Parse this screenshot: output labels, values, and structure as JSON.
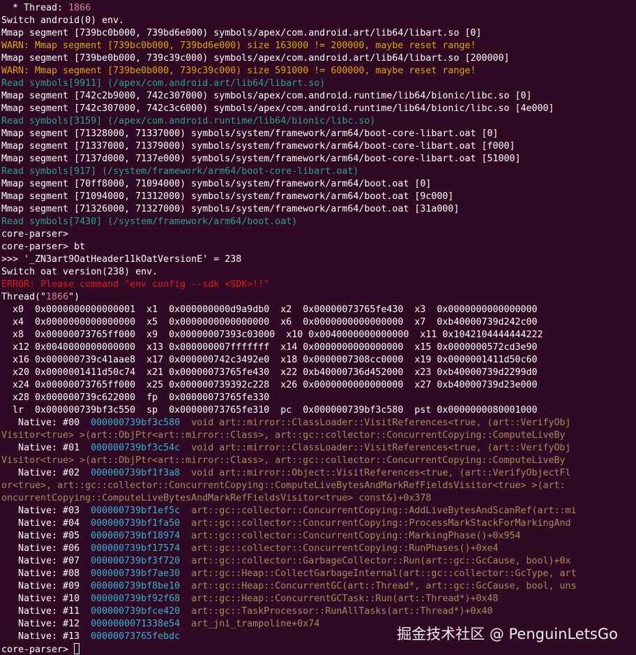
{
  "terminal": {
    "background": "#300a24",
    "colors": {
      "default": "#ffffff",
      "warn": "#e5a50a",
      "read": "#2aa198",
      "error": "#e01b24",
      "thread_id": "#d3869b",
      "frame_symbol": "#a88c5a",
      "frame_address": "#33b3d6"
    },
    "lines": [
      {
        "segs": [
          {
            "t": "  * Thread: ",
            "c": "white"
          },
          {
            "t": "1866",
            "c": "purple"
          }
        ]
      },
      {
        "segs": [
          {
            "t": "Switch android(0) env.",
            "c": "white"
          }
        ]
      },
      {
        "segs": [
          {
            "t": "Mmap segment [739bc0b000, 739bd6e000) symbols/apex/com.android.art/lib64/libart.so [0]",
            "c": "white"
          }
        ]
      },
      {
        "segs": [
          {
            "t": "WARN: Mmap segment [739bc0b000, 739bd6e000) size 163000 != 200000, maybe reset range!",
            "c": "warn"
          }
        ]
      },
      {
        "segs": [
          {
            "t": "Mmap segment [739be0b000, 739c39c000) symbols/apex/com.android.art/lib64/libart.so [200000]",
            "c": "white"
          }
        ]
      },
      {
        "segs": [
          {
            "t": "WARN: Mmap segment [739be0b000, 739c39c000) size 591000 != 600000, maybe reset range!",
            "c": "warn"
          }
        ]
      },
      {
        "segs": [
          {
            "t": "Read symbols[9911] (/apex/com.android.art/lib64/libart.so)",
            "c": "teal"
          }
        ]
      },
      {
        "segs": [
          {
            "t": "Mmap segment [742c2b9000, 742c307000) symbols/apex/com.android.runtime/lib64/bionic/libc.so [0]",
            "c": "white"
          }
        ]
      },
      {
        "segs": [
          {
            "t": "Mmap segment [742c307000, 742c3c6000) symbols/apex/com.android.runtime/lib64/bionic/libc.so [4e000]",
            "c": "white"
          }
        ]
      },
      {
        "segs": [
          {
            "t": "Read symbols[3159] (/apex/com.android.runtime/lib64/bionic/libc.so)",
            "c": "teal"
          }
        ]
      },
      {
        "segs": [
          {
            "t": "Mmap segment [71328000, 71337000) symbols/system/framework/arm64/boot-core-libart.oat [0]",
            "c": "white"
          }
        ]
      },
      {
        "segs": [
          {
            "t": "Mmap segment [71337000, 71379000) symbols/system/framework/arm64/boot-core-libart.oat [f000]",
            "c": "white"
          }
        ]
      },
      {
        "segs": [
          {
            "t": "Mmap segment [7137d000, 7137e000) symbols/system/framework/arm64/boot-core-libart.oat [51000]",
            "c": "white"
          }
        ]
      },
      {
        "segs": [
          {
            "t": "Read symbols[917] (/system/framework/arm64/boot-core-libart.oat)",
            "c": "teal"
          }
        ]
      },
      {
        "segs": [
          {
            "t": "Mmap segment [70ff8000, 71094000) symbols/system/framework/arm64/boot.oat [0]",
            "c": "white"
          }
        ]
      },
      {
        "segs": [
          {
            "t": "Mmap segment [71094000, 71312000) symbols/system/framework/arm64/boot.oat [9c000]",
            "c": "white"
          }
        ]
      },
      {
        "segs": [
          {
            "t": "Mmap segment [71326000, 71327000) symbols/system/framework/arm64/boot.oat [31a000]",
            "c": "white"
          }
        ]
      },
      {
        "segs": [
          {
            "t": "Read symbols[7430] (/system/framework/arm64/boot.oat)",
            "c": "teal"
          }
        ]
      },
      {
        "segs": [
          {
            "t": "core-parser>",
            "c": "white"
          }
        ]
      },
      {
        "segs": [
          {
            "t": "core-parser> bt",
            "c": "white"
          }
        ]
      },
      {
        "segs": [
          {
            "t": ">>> '_ZN3art9OatHeader11kOatVersionE' = 238",
            "c": "white"
          }
        ]
      },
      {
        "segs": [
          {
            "t": "Switch oat version(238) env.",
            "c": "white"
          }
        ]
      },
      {
        "segs": [
          {
            "t": "ERROR: Please command \"env config --sdk <SDK>!!\"",
            "c": "red"
          }
        ]
      },
      {
        "segs": [
          {
            "t": "Thread(\"",
            "c": "white"
          },
          {
            "t": "1866",
            "c": "purple"
          },
          {
            "t": "\")",
            "c": "white"
          }
        ]
      },
      {
        "segs": [
          {
            "t": "  x0  0x0000000000000001  x1  0x000000000d9a9db0  x2  0x00000073765fe430  x3  0x0000000000000000",
            "c": "white"
          }
        ]
      },
      {
        "segs": [
          {
            "t": "  x4  0x0000000000000000  x5  0x0000000000000000  x6  0x0000000000000000  x7  0xb40000739d242c00",
            "c": "white"
          }
        ]
      },
      {
        "segs": [
          {
            "t": "  x8  0x00000073765ff000  x9  0x00000007393c03000  x10 0x0040000000000000  x11 0x1042104444444222",
            "c": "white"
          }
        ]
      },
      {
        "segs": [
          {
            "t": "  x12 0x0040000000000000  x13 0x000000007fffffff  x14 0x0000000000000000  x15 0x0000000572cd3e90",
            "c": "white"
          }
        ]
      },
      {
        "segs": [
          {
            "t": "  x16 0x000000739c41aae8  x17 0x000000742c3492e0  x18 0x0000007308cc0000  x19 0x0000001411d50c60",
            "c": "white"
          }
        ]
      },
      {
        "segs": [
          {
            "t": "  x20 0x0000001411d50c74  x21 0x00000073765fe430  x22 0xb40000736d452000  x23 0xb40000739d2299d0",
            "c": "white"
          }
        ]
      },
      {
        "segs": [
          {
            "t": "  x24 0x00000073765ff000  x25 0x000000739392c228  x26 0x0000000000000000  x27 0xb40000739d23e000",
            "c": "white"
          }
        ]
      },
      {
        "segs": [
          {
            "t": "  x28 0x000000739c622000  fp  0x00000073765fe330",
            "c": "white"
          }
        ]
      },
      {
        "segs": [
          {
            "t": "  lr  0x000000739bf3c550  sp  0x00000073765fe310  pc  0x000000739bf3c580  pst 0x0000000080001000",
            "c": "white"
          }
        ]
      },
      {
        "segs": [
          {
            "t": "   Native: #00  ",
            "c": "white"
          },
          {
            "t": "000000739bf3c580",
            "c": "blue"
          },
          {
            "t": "  void art::mirror::ClassLoader::VisitReferences<true, (art::VerifyObj",
            "c": "tan"
          }
        ]
      },
      {
        "segs": [
          {
            "t": "Visitor<true> >(art::ObjPtr<art::mirror::Class>, art::gc::collector::ConcurrentCopying::ComputeLiveBy",
            "c": "tan"
          }
        ]
      },
      {
        "segs": [
          {
            "t": "   Native: #01  ",
            "c": "white"
          },
          {
            "t": "000000739bf3c54c",
            "c": "blue"
          },
          {
            "t": "  void art::mirror::ClassLoader::VisitReferences<true, (art::VerifyObj",
            "c": "tan"
          }
        ]
      },
      {
        "segs": [
          {
            "t": "Visitor<true> >(art::ObjPtr<art::mirror::Class>, art::gc::collector::ConcurrentCopying::ComputeLiveBy",
            "c": "tan"
          }
        ]
      },
      {
        "segs": [
          {
            "t": "   Native: #02  ",
            "c": "white"
          },
          {
            "t": "000000739bf1f3a8",
            "c": "blue"
          },
          {
            "t": "  void art::mirror::Object::VisitReferences<true, (art::VerifyObjectFl",
            "c": "tan"
          }
        ]
      },
      {
        "segs": [
          {
            "t": "or<true>, art::gc::collector::ConcurrentCopying::ComputeLiveBytesAndMarkRefFieldsVisitor<true> >(art:",
            "c": "tan"
          }
        ]
      },
      {
        "segs": [
          {
            "t": "oncurrentCopying::ComputeLiveBytesAndMarkRefFieldsVisitor<true> const&)+0x378",
            "c": "tan"
          }
        ]
      },
      {
        "segs": [
          {
            "t": "   Native: #03  ",
            "c": "white"
          },
          {
            "t": "000000739bf1ef5c",
            "c": "blue"
          },
          {
            "t": "  art::gc::collector::ConcurrentCopying::AddLiveBytesAndScanRef(art::mi",
            "c": "tan"
          }
        ]
      },
      {
        "segs": [
          {
            "t": "   Native: #04  ",
            "c": "white"
          },
          {
            "t": "000000739bf1fa50",
            "c": "blue"
          },
          {
            "t": "  art::gc::collector::ConcurrentCopying::ProcessMarkStackForMarkingAnd",
            "c": "tan"
          }
        ]
      },
      {
        "segs": [
          {
            "t": "   Native: #05  ",
            "c": "white"
          },
          {
            "t": "000000739bf18974",
            "c": "blue"
          },
          {
            "t": "  art::gc::collector::ConcurrentCopying::MarkingPhase()+0x954",
            "c": "tan"
          }
        ]
      },
      {
        "segs": [
          {
            "t": "   Native: #06  ",
            "c": "white"
          },
          {
            "t": "000000739bf17574",
            "c": "blue"
          },
          {
            "t": "  art::gc::collector::ConcurrentCopying::RunPhases()+0xe4",
            "c": "tan"
          }
        ]
      },
      {
        "segs": [
          {
            "t": "   Native: #07  ",
            "c": "white"
          },
          {
            "t": "000000739bf3f720",
            "c": "blue"
          },
          {
            "t": "  art::gc::collector::GarbageCollector::Run(art::gc::GcCause, bool)+0x",
            "c": "tan"
          }
        ]
      },
      {
        "segs": [
          {
            "t": "   Native: #08  ",
            "c": "white"
          },
          {
            "t": "000000739bf7ae30",
            "c": "blue"
          },
          {
            "t": "  art::gc::Heap::CollectGarbageInternal(art::gc::collector::GcType, art",
            "c": "tan"
          }
        ]
      },
      {
        "segs": [
          {
            "t": "   Native: #09  ",
            "c": "white"
          },
          {
            "t": "000000739bf8be10",
            "c": "blue"
          },
          {
            "t": "  art::gc::Heap::ConcurrentGC(art::Thread*, art::gc::GcCause, bool, uns",
            "c": "tan"
          }
        ]
      },
      {
        "segs": [
          {
            "t": "   Native: #10  ",
            "c": "white"
          },
          {
            "t": "000000739bf92f68",
            "c": "blue"
          },
          {
            "t": "  art::gc::Heap::ConcurrentGCTask::Run(art::Thread*)+0x48",
            "c": "tan"
          }
        ]
      },
      {
        "segs": [
          {
            "t": "   Native: #11  ",
            "c": "white"
          },
          {
            "t": "000000739bfce420",
            "c": "blue"
          },
          {
            "t": "  art::gc::TaskProcessor::RunAllTasks(art::Thread*)+0x40",
            "c": "tan"
          }
        ]
      },
      {
        "segs": [
          {
            "t": "   Native: #12  ",
            "c": "white"
          },
          {
            "t": "0000000071338e54",
            "c": "blue"
          },
          {
            "t": "  art_jni_trampoline+0x74",
            "c": "tan"
          }
        ]
      },
      {
        "segs": [
          {
            "t": "   Native: #13  ",
            "c": "white"
          },
          {
            "t": "00000073765febdc",
            "c": "blue"
          }
        ]
      }
    ],
    "prompt": "core-parser> ",
    "watermark": "掘金技术社区 @ PenguinLetsGo"
  }
}
